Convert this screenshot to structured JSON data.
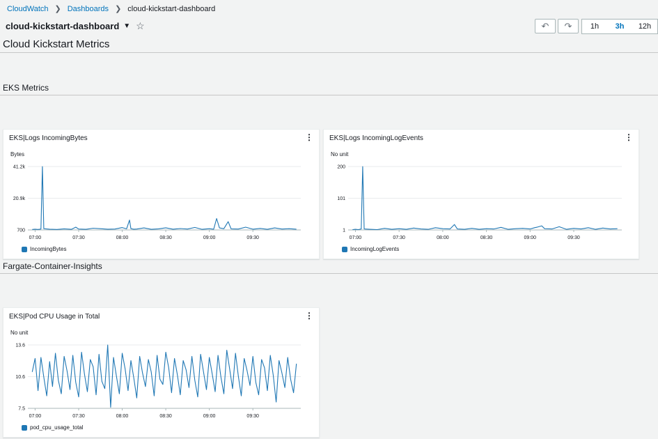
{
  "breadcrumb": {
    "items": [
      "CloudWatch",
      "Dashboards",
      "cloud-kickstart-dashboard"
    ]
  },
  "dashboard": {
    "name": "cloud-kickstart-dashboard"
  },
  "toolbar": {
    "ranges": [
      "1h",
      "3h",
      "12h"
    ],
    "active_range": "3h",
    "undo_icon": "undo-icon",
    "redo_icon": "redo-icon"
  },
  "sections": {
    "main_title": "Cloud Kickstart Metrics",
    "eks": "EKS Metrics",
    "fargate": "Fargate-Container-Insights"
  },
  "colors": {
    "series": "#1f77b4",
    "link": "#0073bb"
  },
  "widgets": [
    {
      "title": "EKS|Logs IncomingBytes",
      "unit": "Bytes",
      "y_ticks": [
        "41.2k",
        "20.9k",
        "700"
      ],
      "x_ticks": [
        "07:00",
        "07:30",
        "08:00",
        "08:30",
        "09:00",
        "09:30"
      ],
      "legend": "IncomingBytes"
    },
    {
      "title": "EKS|Logs IncomingLogEvents",
      "unit": "No unit",
      "y_ticks": [
        "200",
        "101",
        "1"
      ],
      "x_ticks": [
        "07:00",
        "07:30",
        "08:00",
        "08:30",
        "09:00",
        "09:30"
      ],
      "legend": "IncomingLogEvents"
    },
    {
      "title": "EKS|Pod CPU Usage in Total",
      "unit": "No unit",
      "y_ticks": [
        "13.6",
        "10.6",
        "7.5"
      ],
      "x_ticks": [
        "07:00",
        "07:30",
        "08:00",
        "08:30",
        "09:00",
        "09:30"
      ],
      "legend": "pod_cpu_usage_total"
    }
  ],
  "chart_data": [
    {
      "type": "line",
      "title": "EKS|Logs IncomingBytes",
      "ylabel": "Bytes",
      "ylim": [
        700,
        41200
      ],
      "x_ticks": [
        "07:00",
        "07:30",
        "08:00",
        "08:30",
        "09:00",
        "09:30"
      ],
      "grid": "horizontal",
      "legend": "bottom-left",
      "series": [
        {
          "name": "IncomingBytes",
          "x": [
            "06:58",
            "07:00",
            "07:02",
            "07:04",
            "07:05",
            "07:06",
            "07:10",
            "07:15",
            "07:20",
            "07:25",
            "07:28",
            "07:30",
            "07:35",
            "07:40",
            "07:45",
            "07:50",
            "07:55",
            "08:00",
            "08:03",
            "08:05",
            "08:06",
            "08:08",
            "08:10",
            "08:15",
            "08:20",
            "08:25",
            "08:30",
            "08:35",
            "08:40",
            "08:45",
            "08:50",
            "08:55",
            "09:00",
            "09:03",
            "09:05",
            "09:07",
            "09:10",
            "09:13",
            "09:15",
            "09:20",
            "09:25",
            "09:30",
            "09:35",
            "09:40",
            "09:45",
            "09:50",
            "09:55",
            "10:00"
          ],
          "y": [
            1000,
            1200,
            1000,
            1300,
            41200,
            1500,
            1200,
            1000,
            1400,
            1100,
            2500,
            1300,
            1100,
            1800,
            1500,
            1200,
            1300,
            2200,
            1400,
            7000,
            1500,
            1200,
            1300,
            2000,
            1100,
            1400,
            2100,
            1200,
            1600,
            1300,
            2300,
            1100,
            1500,
            1200,
            8000,
            2000,
            1500,
            6000,
            1400,
            1300,
            2500,
            1200,
            1700,
            1100,
            2000,
            1300,
            1500,
            1200
          ]
        }
      ]
    },
    {
      "type": "line",
      "title": "EKS|Logs IncomingLogEvents",
      "ylabel": "No unit",
      "ylim": [
        1,
        200
      ],
      "x_ticks": [
        "07:00",
        "07:30",
        "08:00",
        "08:30",
        "09:00",
        "09:30"
      ],
      "grid": "horizontal",
      "legend": "bottom-left",
      "series": [
        {
          "name": "IncomingLogEvents",
          "x": [
            "06:58",
            "07:00",
            "07:02",
            "07:04",
            "07:05",
            "07:06",
            "07:10",
            "07:15",
            "07:20",
            "07:25",
            "07:30",
            "07:35",
            "07:40",
            "07:45",
            "07:50",
            "07:55",
            "08:00",
            "08:05",
            "08:08",
            "08:10",
            "08:15",
            "08:20",
            "08:25",
            "08:30",
            "08:35",
            "08:40",
            "08:45",
            "08:50",
            "08:55",
            "09:00",
            "09:03",
            "09:05",
            "09:08",
            "09:10",
            "09:15",
            "09:20",
            "09:25",
            "09:30",
            "09:35",
            "09:40",
            "09:45",
            "09:50",
            "09:55",
            "10:00"
          ],
          "y": [
            2,
            3,
            2,
            4,
            200,
            4,
            3,
            2,
            6,
            3,
            5,
            3,
            7,
            4,
            3,
            8,
            5,
            4,
            18,
            4,
            3,
            6,
            3,
            5,
            4,
            9,
            3,
            5,
            6,
            4,
            8,
            10,
            14,
            5,
            4,
            11,
            3,
            6,
            4,
            8,
            3,
            7,
            4,
            5
          ]
        }
      ]
    },
    {
      "type": "line",
      "title": "EKS|Pod CPU Usage in Total",
      "ylabel": "No unit",
      "ylim": [
        7.5,
        13.6
      ],
      "x_ticks": [
        "07:00",
        "07:30",
        "08:00",
        "08:30",
        "09:00",
        "09:30"
      ],
      "grid": "horizontal",
      "legend": "bottom-left",
      "series": [
        {
          "name": "pod_cpu_usage_total",
          "x": [
            "06:58",
            "07:00",
            "07:02",
            "07:04",
            "07:06",
            "07:08",
            "07:10",
            "07:12",
            "07:14",
            "07:16",
            "07:18",
            "07:20",
            "07:22",
            "07:24",
            "07:26",
            "07:28",
            "07:30",
            "07:32",
            "07:34",
            "07:36",
            "07:38",
            "07:40",
            "07:42",
            "07:44",
            "07:46",
            "07:48",
            "07:50",
            "07:52",
            "07:54",
            "07:56",
            "07:58",
            "08:00",
            "08:02",
            "08:04",
            "08:06",
            "08:08",
            "08:10",
            "08:12",
            "08:14",
            "08:16",
            "08:18",
            "08:20",
            "08:22",
            "08:24",
            "08:26",
            "08:28",
            "08:30",
            "08:32",
            "08:34",
            "08:36",
            "08:38",
            "08:40",
            "08:42",
            "08:44",
            "08:46",
            "08:48",
            "08:50",
            "08:52",
            "08:54",
            "08:56",
            "08:58",
            "09:00",
            "09:02",
            "09:04",
            "09:06",
            "09:08",
            "09:10",
            "09:12",
            "09:14",
            "09:16",
            "09:18",
            "09:20",
            "09:22",
            "09:24",
            "09:26",
            "09:28",
            "09:30",
            "09:32",
            "09:34",
            "09:36",
            "09:38",
            "09:40",
            "09:42",
            "09:44",
            "09:46",
            "09:48",
            "09:50",
            "09:52",
            "09:54",
            "09:56",
            "09:58",
            "10:00"
          ],
          "y": [
            11.0,
            12.3,
            9.2,
            12.4,
            10.5,
            8.7,
            12.0,
            9.6,
            12.8,
            10.2,
            8.9,
            12.5,
            11.1,
            9.3,
            12.6,
            10.0,
            8.6,
            12.9,
            10.8,
            9.1,
            12.2,
            11.5,
            8.8,
            12.7,
            10.1,
            9.4,
            13.6,
            7.6,
            12.4,
            10.6,
            8.9,
            12.8,
            11.3,
            9.2,
            12.1,
            10.4,
            8.5,
            12.5,
            10.9,
            9.6,
            12.2,
            11.0,
            8.7,
            12.6,
            10.3,
            9.8,
            12.9,
            11.4,
            9.0,
            12.3,
            10.7,
            8.8,
            12.1,
            11.2,
            9.5,
            12.5,
            10.2,
            8.6,
            12.7,
            11.0,
            9.3,
            12.4,
            10.8,
            9.1,
            12.6,
            10.5,
            8.9,
            13.1,
            11.3,
            9.4,
            12.8,
            10.6,
            8.7,
            12.3,
            11.1,
            9.7,
            12.5,
            10.0,
            8.8,
            12.2,
            11.4,
            9.2,
            12.6,
            10.7,
            8.1,
            12.1,
            10.9,
            9.5,
            12.4,
            10.3,
            9.0,
            11.8
          ]
        }
      ]
    }
  ]
}
